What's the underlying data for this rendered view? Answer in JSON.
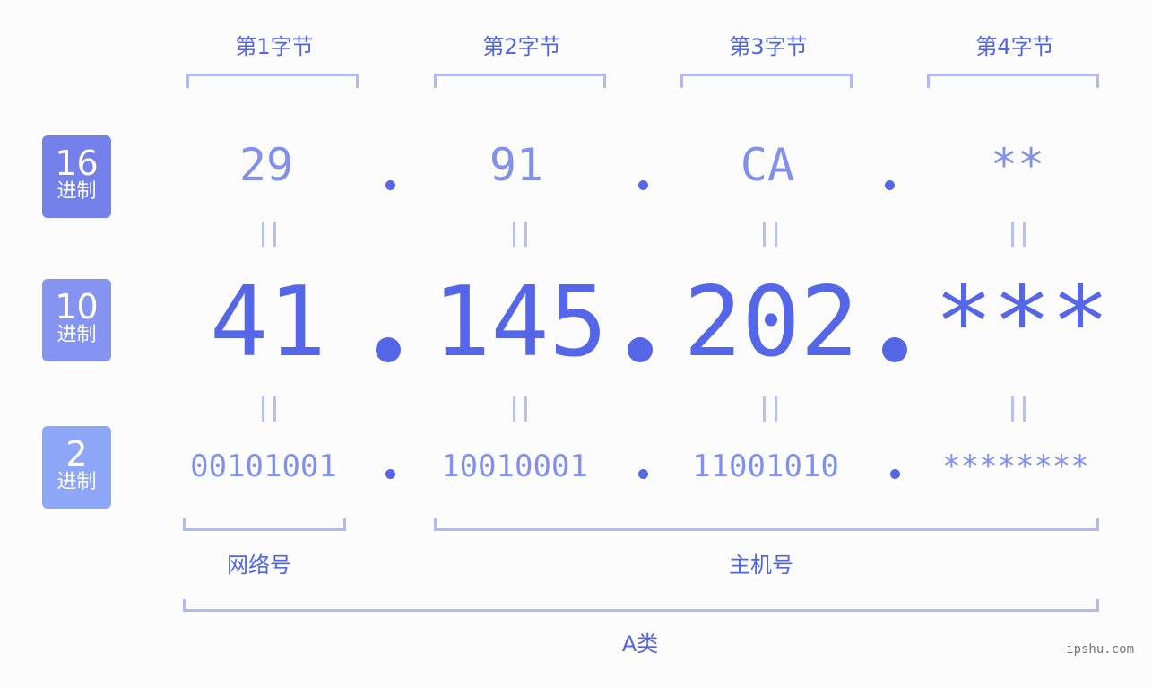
{
  "bytes": [
    {
      "header": "第1字节",
      "hex": "29",
      "dec": "41",
      "bin": "00101001"
    },
    {
      "header": "第2字节",
      "hex": "91",
      "dec": "145",
      "bin": "10010001"
    },
    {
      "header": "第3字节",
      "hex": "CA",
      "dec": "202",
      "bin": "11001010"
    },
    {
      "header": "第4字节",
      "hex": "**",
      "dec": "***",
      "bin": "********"
    }
  ],
  "rows": {
    "hex": {
      "base": "16",
      "label": "进制",
      "color": "#7481ea"
    },
    "dec": {
      "base": "10",
      "label": "进制",
      "color": "#8494f0"
    },
    "bin": {
      "base": "2",
      "label": "进制",
      "color": "#8ea6f8"
    }
  },
  "groups": {
    "network": "网络号",
    "host": "主机号",
    "class": "A类"
  },
  "watermark": "ipshu.com",
  "colors": {
    "accent": "#5567e8",
    "light": "#8090ec",
    "bracket": "#b0baf6"
  }
}
